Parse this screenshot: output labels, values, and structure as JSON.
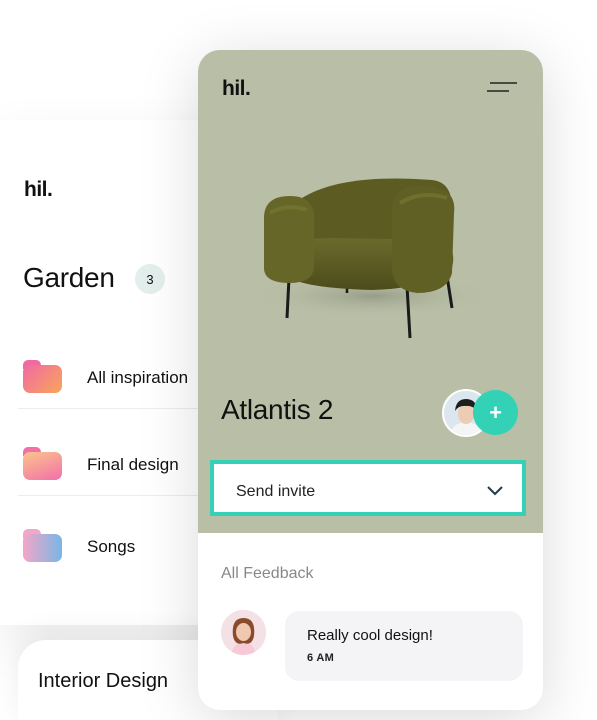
{
  "back_card": {
    "logo": "hil.",
    "title": "Garden",
    "count": "3",
    "folders": [
      {
        "label": "All inspiration",
        "color_a": "#f06aa2",
        "color_b": "#f9a55a"
      },
      {
        "label": "Final design",
        "color_a": "#f36fa8",
        "color_b": "#fac58c"
      },
      {
        "label": "Songs",
        "color_a": "#f4a6c8",
        "color_b": "#79b6e6"
      }
    ]
  },
  "second_card": {
    "title": "Interior Design"
  },
  "front_card": {
    "logo": "hil.",
    "menu_icon": "menu-icon",
    "product_title": "Atlantis 2",
    "add_label": "+",
    "invite": {
      "label": "Send invite",
      "icon": "chevron-down-icon"
    },
    "feedback": {
      "heading": "All Feedback",
      "items": [
        {
          "text": "Really cool design!",
          "time": "6 AM"
        }
      ]
    }
  },
  "colors": {
    "accent": "#33d1b5",
    "hero_bg": "#b9bfa6",
    "badge_bg": "#e3efec",
    "bubble_bg": "#f4f4f6"
  }
}
